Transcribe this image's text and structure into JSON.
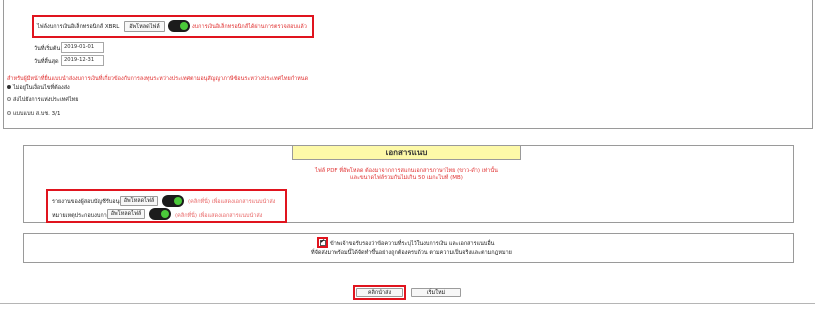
{
  "kbrl": {
    "label": "ไฟล์งบการเงินอิเล็กทรอนิกส์ XBRL",
    "upload_label": "อัพโหลดไฟล์",
    "note": "งบการเงินอิเล็กทรอนิกส์ได้ผ่านการตรวจสอบแล้ว"
  },
  "dates": {
    "start_label": "วันที่เริ่มต้น",
    "start_value": "2019-01-01",
    "end_label": "วันที่สิ้นสุด",
    "end_value": "2019-12-31"
  },
  "branch": {
    "note": "สำหรับผู้มีหน้าที่ยื่นแบบนำส่งงบการเงินที่เกี่ยวข้องกับการลงทุนระหว่างประเทศตามอนุสัญญาภาษีซ้อนระหว่างประเทศไทยกำหนด",
    "options": [
      {
        "label": "ไม่อยู่ในเงื่อนไขที่ต้องส่ง",
        "selected": true
      },
      {
        "label": "ส่งไปยังการแห่งประเทศไทย",
        "selected": false
      },
      {
        "label": "แบบแบบ ส.บช. 3/1",
        "selected": false
      }
    ]
  },
  "attachments": {
    "title": "เอกสารแนบ",
    "note_line1": "ไฟล์ PDF ที่อัพโหลด ต้องมาจากการสแกนเอกสารภาษาไทย (ขาว-ดำ) เท่านั้น",
    "note_line2": "และขนาดไฟล์รวมกันไม่เกิน 50 เมกะไบท์ (MB)",
    "rows": [
      {
        "label": "รายงานของผู้สอบบัญชีรับอนุญาต *",
        "upload_label": "อัพโหลดไฟล์",
        "hint": "(คลิกที่นี่) เพื่อแสดงเอกสารแนบนำส่ง"
      },
      {
        "label": "หมายเหตุประกอบงบการเงิน *",
        "upload_label": "อัพโหลดไฟล์",
        "hint": "(คลิกที่นี่) เพื่อแสดงเอกสารแนบนำส่ง"
      }
    ]
  },
  "confirm": {
    "line1": "ข้าพเจ้าขอรับรองว่าข้อความที่ระบุไว้ในงบการเงิน และเอกสารแนบอื่น",
    "line2": "ที่จัดส่งมาพร้อมนี้ได้จัดทำขึ้นอย่างถูกต้องครบถ้วน ตามความเป็นจริงและตามกฎหมาย",
    "checked": true
  },
  "actions": {
    "submit_label": "คลิกนำส่ง",
    "reset_label": "เริ่มใหม่"
  },
  "colors": {
    "highlight": "#e0141e",
    "header_yellow": "#fdf9a8",
    "toggle_green": "#4bc93a",
    "note_red": "#e03030"
  },
  "icons": {
    "checkbox": "checkmark-icon",
    "toggle": "toggle-on-icon"
  }
}
